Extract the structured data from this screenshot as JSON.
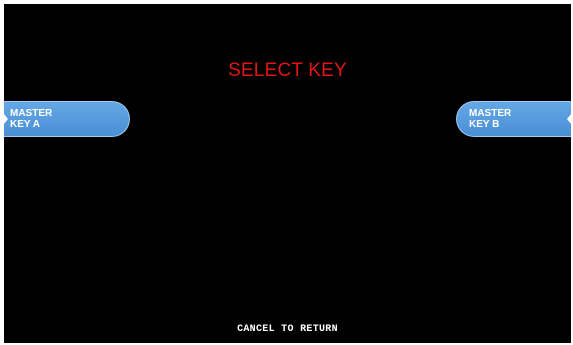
{
  "screen": {
    "title": "SELECT KEY",
    "title_color": "#e01616",
    "background_color": "#000000",
    "button_color": "#5a9fe0"
  },
  "keys": {
    "left": {
      "line1": "MASTER",
      "line2": "KEY A"
    },
    "right": {
      "line1": "MASTER",
      "line2": "KEY B"
    }
  },
  "footer": {
    "text": "CANCEL TO RETURN"
  }
}
